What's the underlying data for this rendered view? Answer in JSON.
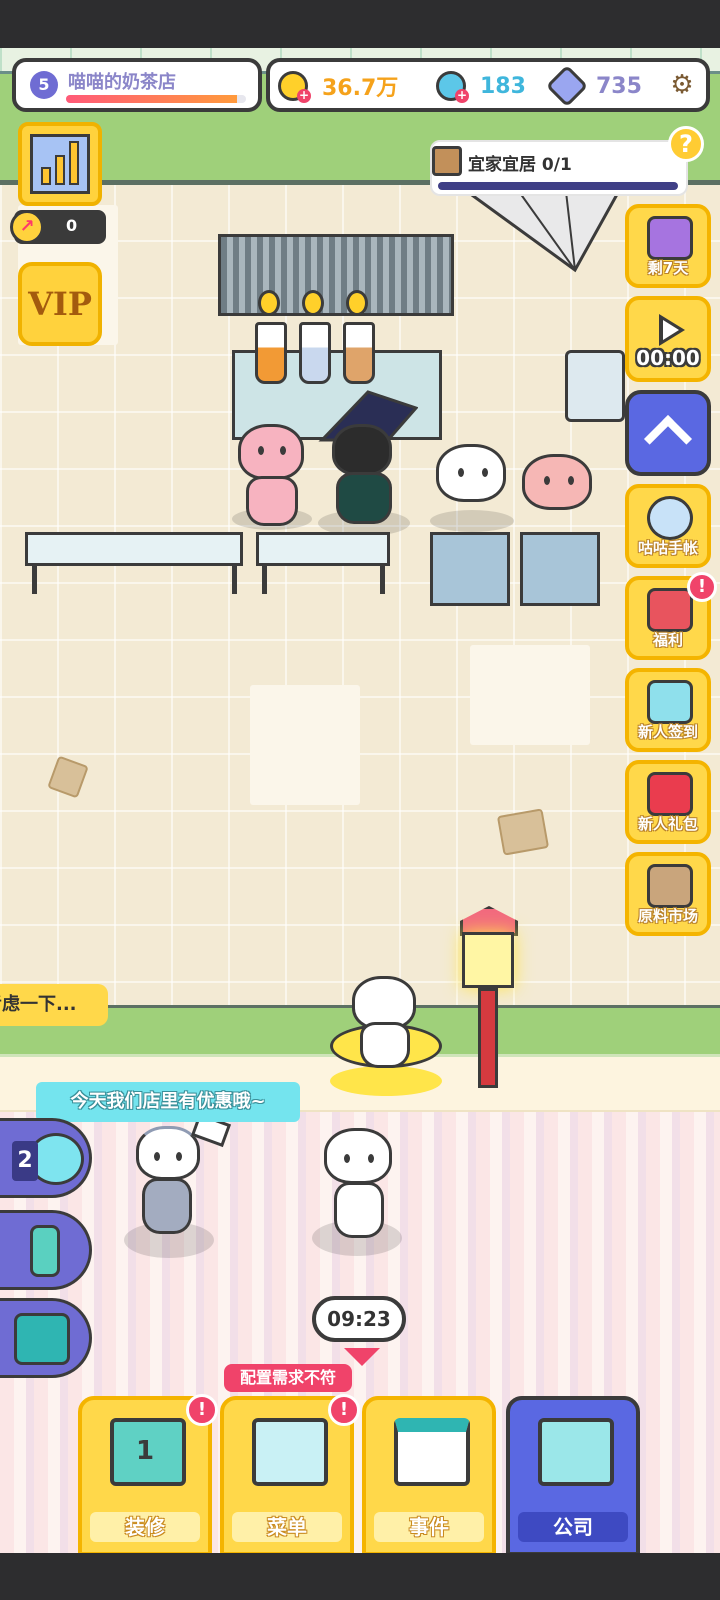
{
  "shop": {
    "level": "5",
    "name": "喵喵的奶茶店",
    "progress": 0.95
  },
  "resources": {
    "gold": {
      "value": "36.7万",
      "color": "#f5a21b",
      "icon": "gold-coin-icon"
    },
    "fish": {
      "value": "183",
      "color": "#3fb6dc",
      "icon": "fish-icon"
    },
    "gem": {
      "value": "735",
      "color": "#8b86c9",
      "icon": "gem-icon"
    }
  },
  "income": {
    "value": "0"
  },
  "vip": {
    "label": "VIP"
  },
  "quest": {
    "label": "宜家宜居 0/1",
    "help": "?"
  },
  "right_panel": {
    "gift_label": "剩7天",
    "ad_timer": "00:00",
    "items": [
      {
        "label": "咕咕手帐",
        "icon": "journal-icon"
      },
      {
        "label": "福利",
        "icon": "red-envelope-icon",
        "alert": "!"
      },
      {
        "label": "新人签到",
        "icon": "calendar-icon"
      },
      {
        "label": "新人礼包",
        "icon": "gift-box-icon"
      },
      {
        "label": "原料市场",
        "icon": "market-icon"
      }
    ]
  },
  "bubbles": {
    "thinking": "考虑一下...",
    "promo": "今天我们店里有优惠哦~"
  },
  "tools": [
    {
      "badge": "2",
      "icon": "magnifier-icon"
    },
    {
      "icon": "shaker-icon"
    },
    {
      "icon": "register-icon"
    }
  ],
  "clock": "09:23",
  "warning": "配置需求不符",
  "bottom_tabs": [
    {
      "label": "装修",
      "alert": "!",
      "badge": "1",
      "icon": "paint-bucket-icon"
    },
    {
      "label": "菜单",
      "alert": "!",
      "icon": "menu-list-icon"
    },
    {
      "label": "事件",
      "icon": "schedule-icon"
    },
    {
      "label": "公司",
      "icon": "office-building-icon"
    }
  ],
  "colors": {
    "accent": "#5a68e2",
    "button": "#ffd84a",
    "alert": "#f0436a"
  }
}
